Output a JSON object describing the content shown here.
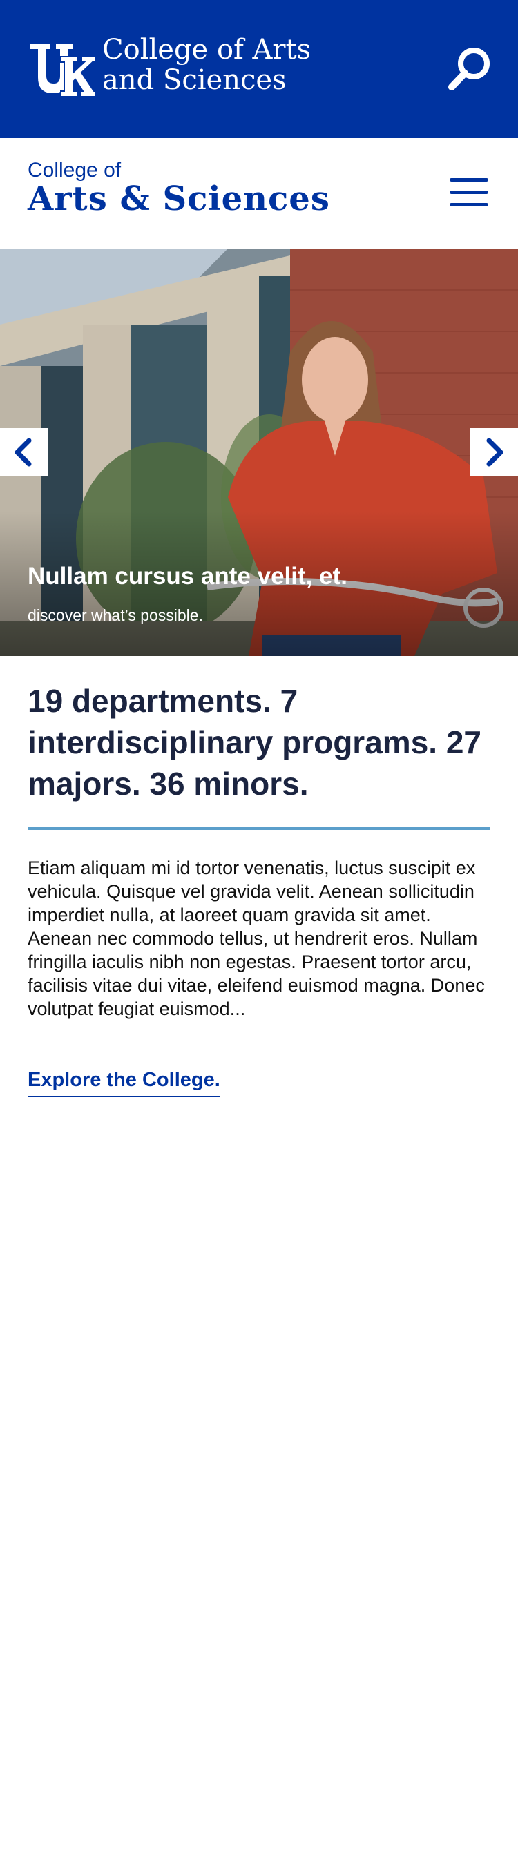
{
  "colors": {
    "brand_blue": "#0033a0",
    "accent_line": "#5b9fcb",
    "text_dark": "#1b2440"
  },
  "header": {
    "logo_icon": "uk-logo-icon",
    "title_line1": "College of Arts",
    "title_line2": "and Sciences",
    "search_icon": "search-icon"
  },
  "brand": {
    "small": "College of",
    "big": "Arts & Sciences",
    "menu_icon": "hamburger-menu-icon"
  },
  "hero": {
    "title": "Nullam cursus ante velit, et.",
    "subtitle": "discover what’s possible.",
    "prev_icon": "chevron-left-icon",
    "next_icon": "chevron-right-icon"
  },
  "main": {
    "stats_heading": "19 departments. 7 interdisciplinary programs. 27 majors. 36 minors.",
    "paragraph": "Etiam aliquam mi id tortor venenatis, luctus suscipit ex vehicula. Quisque vel gravida velit. Aenean sollicitudin imperdiet nulla, at laoreet quam gravida sit amet. Aenean nec commodo tellus, ut hendrerit eros. Nullam fringilla iaculis nibh non egestas. Praesent tortor arcu, facilisis vitae dui vitae, eleifend euismod magna. Donec volutpat feugiat euismod...",
    "link_label": "Explore the College."
  }
}
